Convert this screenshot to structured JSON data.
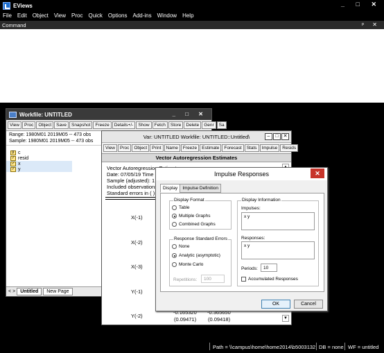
{
  "app": {
    "title": "EViews",
    "controls": [
      "_",
      "□",
      "✕"
    ]
  },
  "menu": [
    "File",
    "Edit",
    "Object",
    "View",
    "Proc",
    "Quick",
    "Options",
    "Add-ins",
    "Window",
    "Help"
  ],
  "command": {
    "label": "Command",
    "controls": "ᵖ ✕"
  },
  "workfile": {
    "title": "Workfile: UNTITLED",
    "controls": "_ □ ✕",
    "toolbar": [
      "View",
      "Proc",
      "Object",
      "Save",
      "Snapshot",
      "Freeze",
      "Details+/-",
      "Show",
      "Fetch",
      "Store",
      "Delete",
      "Genr",
      "Sa"
    ],
    "range": "Range:  1980M01 2019M05  --  473 obs",
    "sample": "Sample: 1980M01 2019M05  --  473 obs",
    "objects": [
      {
        "icon": "β",
        "name": "c"
      },
      {
        "icon": "✓",
        "name": "resid"
      },
      {
        "icon": "✓",
        "name": "x"
      },
      {
        "icon": "✓",
        "name": "y"
      }
    ],
    "tabs": [
      "<",
      ">",
      "Untitled",
      "New Page"
    ]
  },
  "var_window": {
    "title": "Var: UNTITLED   Workfile: UNTITLED::Untitled\\",
    "toolbar": [
      "View",
      "Proc",
      "Object",
      "Print",
      "Name",
      "Freeze",
      "Estimate",
      "Forecast",
      "Stats",
      "Impulse",
      "Resids"
    ],
    "header": "Vector Autoregression Estimates",
    "lines": [
      "Vector Autoregression Estimates",
      "Date: 07/05/19   Time",
      "Sample (adjusted): 1",
      "Included observations",
      "Standard errors in ( )"
    ],
    "row_labels": [
      "X(-1)",
      "X(-2)",
      "X(-3)",
      "Y(-1)",
      "Y(-2)"
    ],
    "bottom_values": [
      "-0.165320",
      "(0.09471)",
      "-0.365650",
      "(0.09418)"
    ]
  },
  "dialog": {
    "title": "Impulse Responses",
    "close": "✕",
    "tabs": [
      "Display",
      "Impulse Definition"
    ],
    "display_format": {
      "label": "Display Format",
      "options": [
        "Table",
        "Multiple Graphs",
        "Combined Graphs"
      ],
      "selected": 1
    },
    "std_errors": {
      "label": "Response Standard Errors",
      "options": [
        "None",
        "Analytic (asymptotic)",
        "Monte Carlo"
      ],
      "selected": 1
    },
    "repetitions_label": "Repetitions:",
    "repetitions_value": "100",
    "display_info": "Display Information",
    "impulses_label": "Impulses:",
    "impulses_value": "x y",
    "responses_label": "Responses:",
    "responses_value": "x y",
    "periods_label": "Periods:",
    "periods_value": "10",
    "accumulated_label": "Accumulated Responses",
    "ok": "OK",
    "cancel": "Cancel"
  },
  "status": {
    "path": "Path = \\\\campus\\home\\home2014\\b5003132",
    "db": "DB = none",
    "wf": "WF = untitled"
  }
}
